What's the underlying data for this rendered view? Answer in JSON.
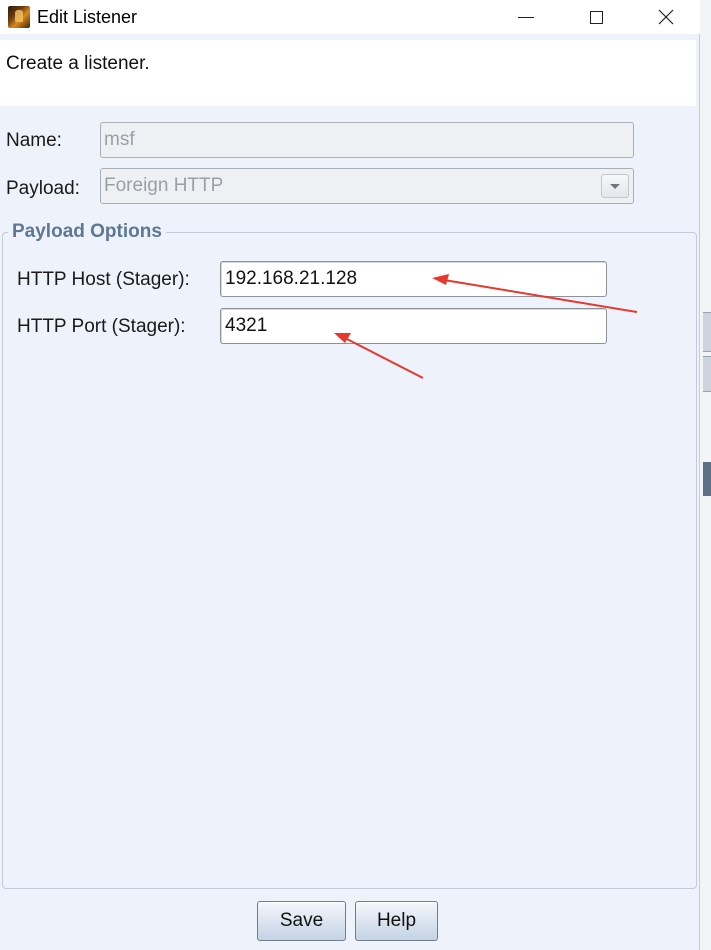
{
  "window": {
    "title": "Edit Listener",
    "controls": {
      "minimize_icon": "minimize-icon",
      "maximize_icon": "maximize-icon",
      "close_icon": "close-icon",
      "close_glyph": "✕"
    }
  },
  "description": "Create a listener.",
  "form": {
    "name": {
      "label": "Name:",
      "value": "msf",
      "enabled": false
    },
    "payload": {
      "label": "Payload:",
      "selected": "Foreign HTTP",
      "enabled": false
    }
  },
  "payload_options": {
    "title": "Payload Options",
    "host": {
      "label": "HTTP Host (Stager):",
      "value": "192.168.21.128"
    },
    "port": {
      "label": "HTTP Port (Stager):",
      "value": "4321"
    }
  },
  "buttons": {
    "save": "Save",
    "help": "Help"
  },
  "annotations": {
    "arrow_color": "#e8372c"
  }
}
